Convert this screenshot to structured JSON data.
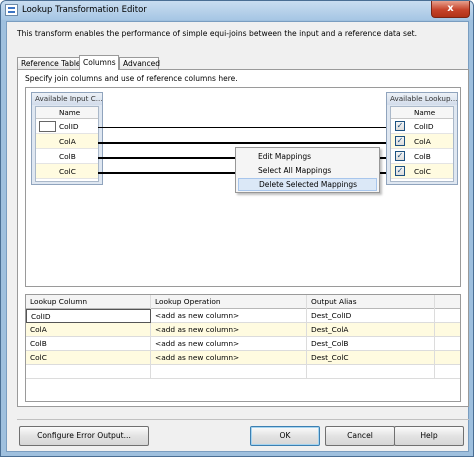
{
  "window": {
    "title": "Lookup Transformation Editor",
    "close_glyph": "x"
  },
  "description": "This transform enables the performance of simple equi-joins between the input and a reference data set.",
  "tabs": [
    {
      "label": "Reference Table",
      "selected": false
    },
    {
      "label": "Columns",
      "selected": true
    },
    {
      "label": "Advanced",
      "selected": false
    }
  ],
  "panel": {
    "instruction": "Specify join columns and use of reference columns here."
  },
  "input_table": {
    "title": "Available Input C...",
    "header": "Name",
    "columns": [
      "ColID",
      "ColA",
      "ColB",
      "ColC"
    ]
  },
  "lookup_table": {
    "title": "Available Lookup...",
    "header": "Name",
    "columns": [
      "ColID",
      "ColA",
      "ColB",
      "ColC"
    ],
    "checked": [
      true,
      true,
      true,
      true
    ],
    "check_glyph": "✓"
  },
  "context_menu": {
    "items": [
      "Edit Mappings",
      "Select All Mappings",
      "Delete Selected Mappings"
    ],
    "hovered_index": 2
  },
  "grid": {
    "headers": [
      "Lookup Column",
      "Lookup Operation",
      "Output Alias"
    ],
    "rows": [
      {
        "lookup_column": "ColID",
        "operation": "<add as new column>",
        "alias": "Dest_ColID"
      },
      {
        "lookup_column": "ColA",
        "operation": "<add as new column>",
        "alias": "Dest_ColA"
      },
      {
        "lookup_column": "ColB",
        "operation": "<add as new column>",
        "alias": "Dest_ColB"
      },
      {
        "lookup_column": "ColC",
        "operation": "<add as new column>",
        "alias": "Dest_ColC"
      }
    ]
  },
  "buttons": {
    "configure_error_output": "Configure Error Output...",
    "ok": "OK",
    "cancel": "Cancel",
    "help": "Help"
  },
  "colors": {
    "title_bar": "#a6c6e4",
    "close_button": "#c6432a",
    "row_highlight": "#fffbe0",
    "menu_hover": "#dbe8f7"
  }
}
